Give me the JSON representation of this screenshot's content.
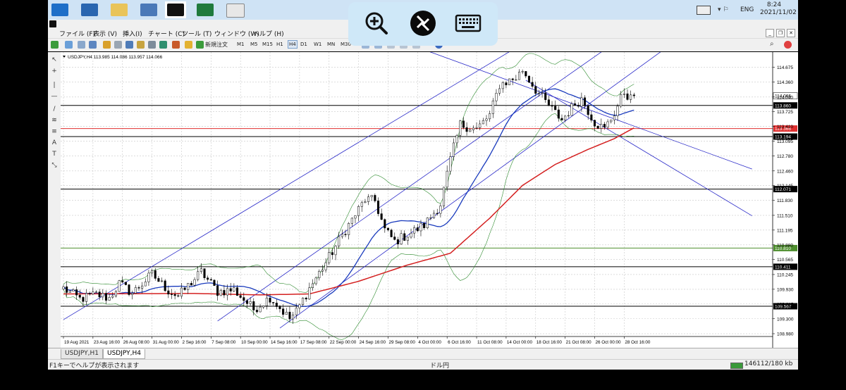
{
  "menubar": {
    "items": [
      "ファイル (F)",
      "表示 (V)",
      "挿入(I)",
      "チャート (C)",
      "ツール (T)",
      "ウィンドウ (W)",
      "ヘルプ (H)"
    ]
  },
  "taskbar": {
    "lang": "ENG",
    "time": "8:24",
    "date": "2021/11/02",
    "apps": [
      "windows-icon",
      "sigma-app-icon",
      "file-explorer-icon",
      "network-app-icon",
      "xm-app-icon",
      "excel-icon",
      "settings-app-icon"
    ]
  },
  "toolbar": {
    "new_order_label": "新規注文",
    "timeframes": [
      "M1",
      "M5",
      "M15",
      "H1",
      "H4",
      "D1",
      "W1",
      "MN",
      "M30"
    ]
  },
  "chart": {
    "symbol_info": "USDJPY,H4 113.985 114.086 113.957 114.066"
  },
  "tabs": [
    "USDJPY,H1",
    "USDJPY,H4"
  ],
  "status": {
    "help": "F1キーでヘルプが表示されます",
    "profile": "ドル円",
    "traffic": "146112/180 kb"
  },
  "colors": {
    "price_line": "#000000",
    "resistance": "#000000",
    "red_level": "#e03030",
    "green_level": "#4f8f2f",
    "channel": "#2929c8",
    "bollinger": "#2e8b2e",
    "ma_fast": "#1a3bbd",
    "ma_slow": "#d42020"
  },
  "chart_data": {
    "type": "candlestick",
    "y_ticks": [
      114.675,
      114.36,
      114.04,
      113.725,
      113.41,
      113.095,
      112.78,
      112.46,
      112.145,
      111.83,
      111.51,
      111.195,
      110.88,
      110.565,
      110.245,
      109.93,
      109.615,
      109.3,
      108.98
    ],
    "ylim": [
      108.92,
      114.97
    ],
    "x_ticks": [
      "19 Aug 2021",
      "23 Aug 16:00",
      "26 Aug 08:00",
      "31 Aug 00:00",
      "2 Sep 16:00",
      "7 Sep 08:00",
      "10 Sep 00:00",
      "14 Sep 16:00",
      "17 Sep 08:00",
      "22 Sep 00:00",
      "24 Sep 16:00",
      "29 Sep 08:00",
      "4 Oct 00:00",
      "6 Oct 16:00",
      "11 Oct 08:00",
      "14 Oct 00:00",
      "18 Oct 16:00",
      "21 Oct 08:00",
      "26 Oct 00:00",
      "28 Oct 16:00"
    ],
    "horizontal_levels": [
      {
        "value": 114.066,
        "label": "114.066",
        "kind": "current"
      },
      {
        "value": 113.86,
        "label": "113.860",
        "kind": "black"
      },
      {
        "value": 113.366,
        "label": "113.366",
        "kind": "red"
      },
      {
        "value": 113.194,
        "label": "113.194",
        "kind": "black"
      },
      {
        "value": 112.071,
        "label": "112.071",
        "kind": "black"
      },
      {
        "value": 110.81,
        "label": "110.810",
        "kind": "green"
      },
      {
        "value": 110.411,
        "label": "110.411",
        "kind": "black"
      },
      {
        "value": 109.567,
        "label": "109.567",
        "kind": "black"
      }
    ],
    "key_points": [
      {
        "i": 0,
        "v": 109.95
      },
      {
        "i": 5,
        "v": 109.72
      },
      {
        "i": 10,
        "v": 109.82
      },
      {
        "i": 14,
        "v": 109.74
      },
      {
        "i": 17,
        "v": 110.05
      },
      {
        "i": 21,
        "v": 109.85
      },
      {
        "i": 27,
        "v": 110.25
      },
      {
        "i": 32,
        "v": 109.9
      },
      {
        "i": 35,
        "v": 109.78
      },
      {
        "i": 42,
        "v": 110.3
      },
      {
        "i": 47,
        "v": 109.88
      },
      {
        "i": 52,
        "v": 109.92
      },
      {
        "i": 58,
        "v": 109.5
      },
      {
        "i": 63,
        "v": 109.76
      },
      {
        "i": 69,
        "v": 109.3
      },
      {
        "i": 71,
        "v": 109.45
      },
      {
        "i": 75,
        "v": 109.95
      },
      {
        "i": 80,
        "v": 110.5
      },
      {
        "i": 86,
        "v": 111.2
      },
      {
        "i": 92,
        "v": 111.85
      },
      {
        "i": 95,
        "v": 111.82
      },
      {
        "i": 98,
        "v": 111.2
      },
      {
        "i": 101,
        "v": 110.95
      },
      {
        "i": 105,
        "v": 111.1
      },
      {
        "i": 110,
        "v": 111.3
      },
      {
        "i": 115,
        "v": 111.75
      },
      {
        "i": 118,
        "v": 112.7
      },
      {
        "i": 121,
        "v": 113.45
      },
      {
        "i": 126,
        "v": 113.35
      },
      {
        "i": 130,
        "v": 113.65
      },
      {
        "i": 133,
        "v": 114.3
      },
      {
        "i": 138,
        "v": 114.45
      },
      {
        "i": 140,
        "v": 114.62
      },
      {
        "i": 144,
        "v": 114.2
      },
      {
        "i": 148,
        "v": 113.85
      },
      {
        "i": 152,
        "v": 113.55
      },
      {
        "i": 156,
        "v": 113.9
      },
      {
        "i": 158,
        "v": 114.0
      },
      {
        "i": 162,
        "v": 113.5
      },
      {
        "i": 165,
        "v": 113.35
      },
      {
        "i": 168,
        "v": 113.7
      },
      {
        "i": 171,
        "v": 114.15
      },
      {
        "i": 173,
        "v": 114.0
      },
      {
        "i": 174,
        "v": 114.066
      }
    ],
    "ma_slow": [
      {
        "i": 0,
        "v": 109.83
      },
      {
        "i": 40,
        "v": 109.84
      },
      {
        "i": 60,
        "v": 109.81
      },
      {
        "i": 75,
        "v": 109.83
      },
      {
        "i": 90,
        "v": 110.1
      },
      {
        "i": 105,
        "v": 110.45
      },
      {
        "i": 118,
        "v": 110.7
      },
      {
        "i": 130,
        "v": 111.45
      },
      {
        "i": 140,
        "v": 112.15
      },
      {
        "i": 150,
        "v": 112.6
      },
      {
        "i": 160,
        "v": 112.92
      },
      {
        "i": 168,
        "v": 113.15
      },
      {
        "i": 174,
        "v": 113.38
      }
    ],
    "channel_lines": [
      {
        "a": {
          "i": 0,
          "v": 109.28
        },
        "b": {
          "i": 137,
          "v": 115.05
        }
      },
      {
        "a": {
          "i": 47,
          "v": 109.25
        },
        "b": {
          "i": 165,
          "v": 115.05
        }
      },
      {
        "a": {
          "i": 66,
          "v": 109.1
        },
        "b": {
          "i": 183,
          "v": 115.05
        }
      },
      {
        "a": {
          "i": 110,
          "v": 115.05
        },
        "b": {
          "i": 210,
          "v": 112.5
        }
      },
      {
        "a": {
          "i": 141,
          "v": 114.4
        },
        "b": {
          "i": 210,
          "v": 111.5
        }
      }
    ],
    "vertical_lines_x": [
      0,
      1
    ]
  }
}
